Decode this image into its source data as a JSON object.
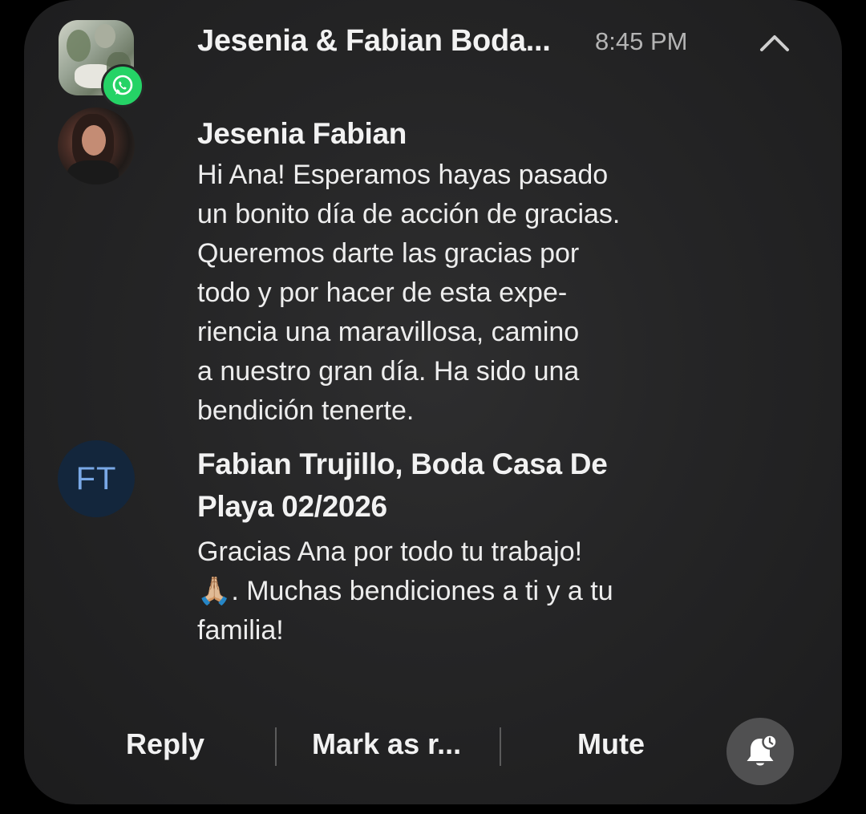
{
  "notification": {
    "app": "WhatsApp",
    "group_title": "Jesenia & Fabian Boda...",
    "time": "8:45 PM"
  },
  "messages": [
    {
      "sender": "Jesenia Fabian",
      "text": "Hi Ana! Esperamos hayas pasado\nun bonito día de acción de gracias.\nQueremos darte las gracias por\ntodo y por hacer de esta expe-\nriencia una maravillosa, camino\na nuestro gran día. Ha sido una\nbendición tenerte."
    },
    {
      "sender": "Fabian Trujillo, Boda Casa De\nPlaya 02/2026",
      "initials": "FT",
      "text": "Gracias Ana por todo tu trabajo!\n🙏🏼. Muchas bendiciones a ti y a tu\nfamilia!"
    }
  ],
  "actions": {
    "reply": "Reply",
    "mark_as_read": "Mark as r...",
    "mute": "Mute"
  },
  "icons": {
    "app_badge": "whatsapp-icon",
    "collapse": "chevron-up-icon",
    "snooze": "bell-snooze-icon"
  },
  "colors": {
    "whatsapp_green": "#25d366",
    "card_background": "#262627",
    "initials_avatar_bg": "#13263c",
    "initials_avatar_text": "#79a8e6"
  }
}
